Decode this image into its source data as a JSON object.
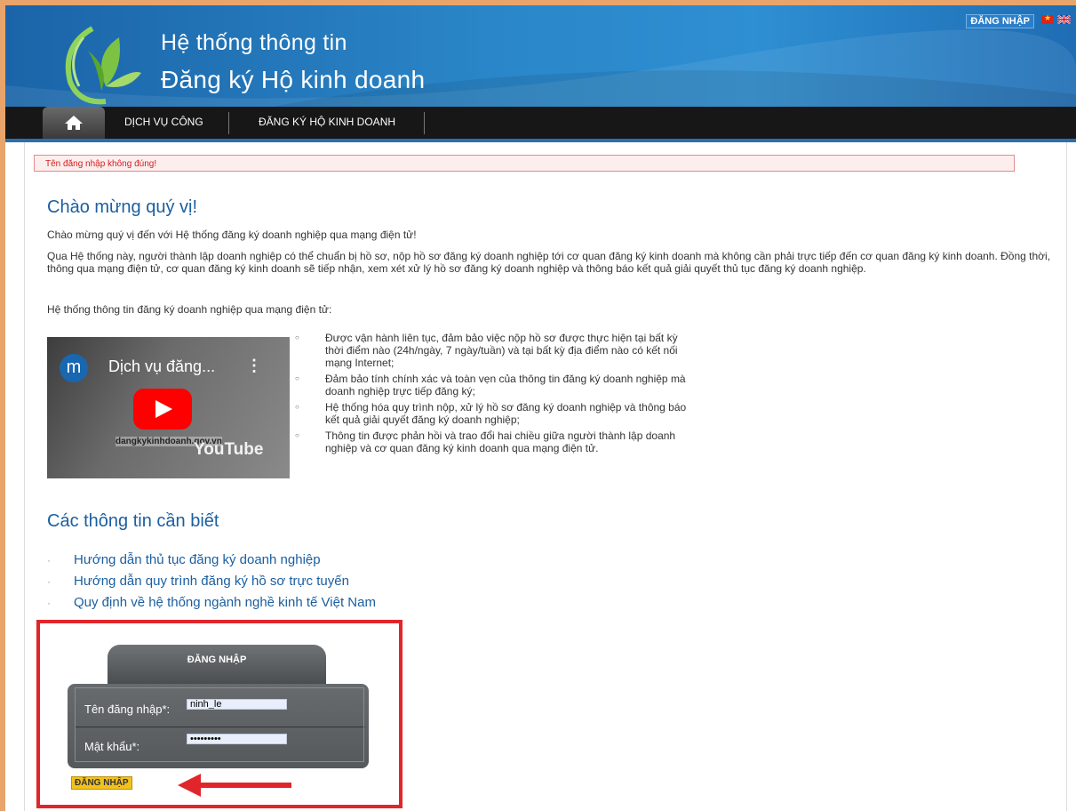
{
  "header": {
    "title_line1": "Hệ thống thông tin",
    "title_line2": "Đăng ký Hộ kinh doanh",
    "top_login": "ĐĂNG NHẬP"
  },
  "nav": {
    "items": [
      {
        "label": "DỊCH VỤ CÔNG"
      },
      {
        "label": "ĐĂNG KÝ HỘ KINH DOANH"
      }
    ]
  },
  "error_message": "Tên đăng nhập không đúng!",
  "welcome": {
    "heading": "Chào mừng quý vị!",
    "line1": "Chào mừng quý vị đến với Hệ thống đăng ký doanh nghiệp qua mạng điện tử!",
    "line2": "Qua Hệ thống này, người thành lập doanh nghiệp có thể chuẩn bị hồ sơ, nộp hồ sơ đăng ký doanh nghiệp tới cơ quan đăng ký kinh doanh mà không cần phải trực tiếp đến cơ quan đăng ký kinh doanh. Đồng thời, thông qua mạng điện tử, cơ quan đăng ký kinh doanh sẽ tiếp nhận, xem xét xử lý hồ sơ đăng ký doanh nghiệp và thông báo kết quả giải quyết thủ tục đăng ký doanh nghiệp.",
    "line3": "Hệ thống thông tin đăng ký doanh nghiệp qua mạng điện tử:"
  },
  "video": {
    "channel_initial": "m",
    "title": "Dịch vụ đăng...",
    "domain_text": "dangkykinhdoanh.gov.vn",
    "platform": "YouTube"
  },
  "bullets": [
    "Được vận hành liên tục, đảm bảo việc nộp hồ sơ được thực hiện tại bất kỳ thời điểm nào (24h/ngày, 7 ngày/tuần) và tại bất kỳ địa điểm nào có kết nối mạng Internet;",
    "Đảm bảo tính chính xác và toàn vẹn của thông tin đăng ký doanh nghiệp mà doanh nghiệp trực tiếp đăng ký;",
    "Hệ thống hóa quy trình nộp, xử lý hồ sơ đăng ký doanh nghiệp và thông báo kết quả giải quyết đăng ký doanh nghiệp;",
    "Thông tin được phản hồi và trao đổi hai chiều giữa người thành lập doanh nghiệp và cơ quan đăng ký kinh doanh qua mạng điện tử."
  ],
  "info": {
    "heading": "Các thông tin cần biết",
    "links": [
      "Hướng dẫn thủ tục đăng ký doanh nghiệp",
      "Hướng dẫn quy trình đăng ký hồ sơ trực tuyến",
      "Quy định về hệ thống ngành nghề kinh tế Việt Nam"
    ]
  },
  "login": {
    "title": "ĐĂNG NHẬP",
    "username_label": "Tên đăng nhập*:",
    "username_value": "ninh_le",
    "password_label": "Mật khẩu*:",
    "password_value": "•••••••••",
    "button": "ĐĂNG NHẬP"
  },
  "colors": {
    "accent": "#1b5fa0",
    "header_blue": "#2a86c8",
    "highlight": "#e0262a",
    "button": "#f2c21c"
  }
}
